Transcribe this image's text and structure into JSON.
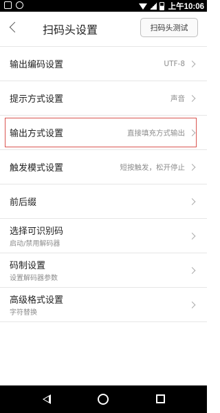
{
  "status_bar": {
    "time": "上午10:06",
    "icons": [
      "notification-icon",
      "sync-icon",
      "wifi-icon",
      "signal-icon",
      "battery-icon"
    ]
  },
  "header": {
    "title": "扫码头设置",
    "test_button": "扫码头测试",
    "back_icon": "chevron-left-icon"
  },
  "settings": [
    {
      "label": "输出编码设置",
      "value": "UTF-8"
    },
    {
      "label": "提示方式设置",
      "value": "声音"
    },
    {
      "label": "输出方式设置",
      "value": "直接填充方式输出",
      "highlighted": true
    },
    {
      "label": "触发模式设置",
      "value": "短按触发，松开停止"
    },
    {
      "label": "前后缀",
      "value": ""
    },
    {
      "label": "选择可识别码",
      "sub": "启动/禁用解码器"
    },
    {
      "label": "码制设置",
      "sub": "设置解码器参数"
    },
    {
      "label": "高级格式设置",
      "sub": "字符替换"
    }
  ],
  "nav_bar": {
    "icons": [
      "back-triangle-icon",
      "home-circle-icon",
      "recents-square-icon"
    ]
  },
  "colors": {
    "highlight_border": "#d9534f",
    "divider": "#e6e6e6",
    "secondary_text": "#8c8c8c"
  }
}
